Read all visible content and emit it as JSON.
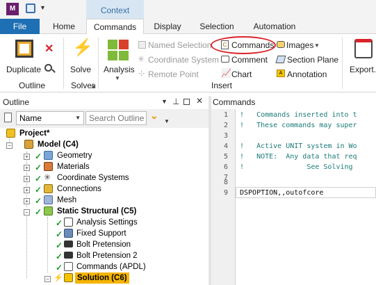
{
  "app": {
    "logo_letter": "M",
    "context_label": "Context"
  },
  "tabs": [
    "File",
    "Home",
    "Commands",
    "Display",
    "Selection",
    "Automation"
  ],
  "ribbon": {
    "duplicate": "Duplicate",
    "outline_group": "Outline",
    "solve": "Solve",
    "solver_group": "Solver",
    "analysis": "Analysis",
    "named_selection": "Named Selection",
    "coordinate_system": "Coordinate System",
    "remote_point": "Remote Point",
    "commands": "Commands",
    "comment": "Comment",
    "chart": "Chart",
    "images": "Images",
    "section_plane": "Section Plane",
    "annotation": "Annotation",
    "insert_group": "Insert",
    "export": "Export..."
  },
  "outline": {
    "title": "Outline",
    "filter_select": "Name",
    "search_placeholder": "Search Outline",
    "tree": [
      {
        "label": "Project*",
        "bold": true
      },
      {
        "label": "Model (C4)",
        "bold": true
      },
      {
        "label": "Geometry"
      },
      {
        "label": "Materials"
      },
      {
        "label": "Coordinate Systems"
      },
      {
        "label": "Connections"
      },
      {
        "label": "Mesh"
      },
      {
        "label": "Static Structural (C5)",
        "bold": true
      },
      {
        "label": "Analysis Settings"
      },
      {
        "label": "Fixed Support"
      },
      {
        "label": "Bolt Pretension"
      },
      {
        "label": "Bolt Pretension 2"
      },
      {
        "label": "Commands (APDL)"
      },
      {
        "label": "Solution (C6)",
        "bold": true,
        "highlighted": true
      }
    ]
  },
  "commands_panel": {
    "title": "Commands",
    "lines": [
      {
        "n": "1",
        "text": "!   Commands inserted into t"
      },
      {
        "n": "2",
        "text": "!   These commands may super"
      },
      {
        "n": "3",
        "text": ""
      },
      {
        "n": "4",
        "text": "!   Active UNIT system in Wo"
      },
      {
        "n": "5",
        "text": "!   NOTE:  Any data that req"
      },
      {
        "n": "6",
        "text": "!               See Solving"
      },
      {
        "n": "7",
        "text": ""
      },
      {
        "n": "8",
        "text": ""
      },
      {
        "n": "9",
        "text": "DSPOPTION,,outofcore"
      }
    ]
  },
  "colors": {
    "accent": "#1e6fb3",
    "highlight": "#f5b400",
    "annotation_circle": "#d8232a",
    "check": "#1d9a2a"
  }
}
